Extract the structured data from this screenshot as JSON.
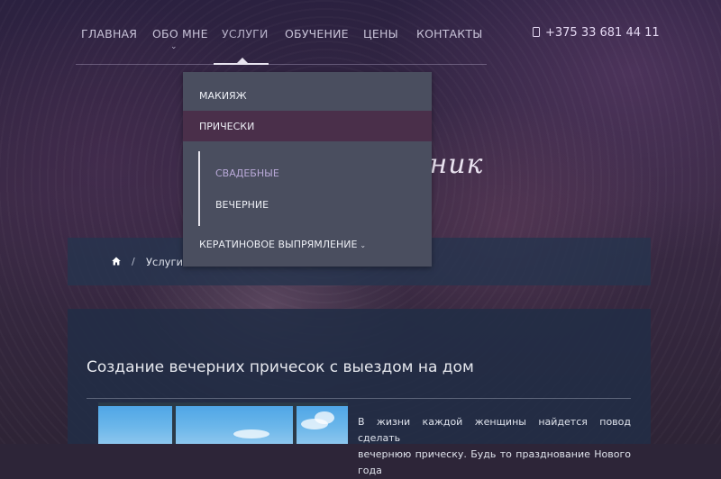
{
  "nav": {
    "items": [
      {
        "label": "ГЛАВНАЯ"
      },
      {
        "label": "ОБО МНЕ"
      },
      {
        "label": "УСЛУГИ"
      },
      {
        "label": "ОБУЧЕНИЕ"
      },
      {
        "label": "ЦЕНЫ"
      },
      {
        "label": "КОНТАКТЫ"
      }
    ],
    "active": "УСЛУГИ",
    "about_chevron": "⌄"
  },
  "phone": {
    "number": "+375 33 681 44 11",
    "icon": "phone-icon"
  },
  "hero": {
    "script_title_fragment": "вник"
  },
  "dropdown": {
    "items": {
      "makeup": "МАКИЯЖ",
      "hairstyles": "ПРИЧЕСКИ",
      "keratin": "КЕРАТИНОВОЕ ВЫПРЯМЛЕНИЕ",
      "keratin_chevron": "⌄"
    },
    "subitems": {
      "wedding": "СВАДЕБНЫЕ",
      "evening": "ВЕЧЕРНИЕ"
    }
  },
  "breadcrumb": {
    "home_icon": "home-icon",
    "separator": "/",
    "link": "Услуги"
  },
  "content": {
    "title": "Создание вечерних причесок с выездом на дом",
    "text_line1": "В жизни каждой женщины найдется повод сделать",
    "text_line2": "вечернюю прическу. Будь то празднование Нового года"
  },
  "colors": {
    "dropdown_bg": "#4a4e5f",
    "dropdown_active": "#4a2f4a",
    "submenu_highlight": "#b9a9d8",
    "panel_bg": "#222e46"
  }
}
